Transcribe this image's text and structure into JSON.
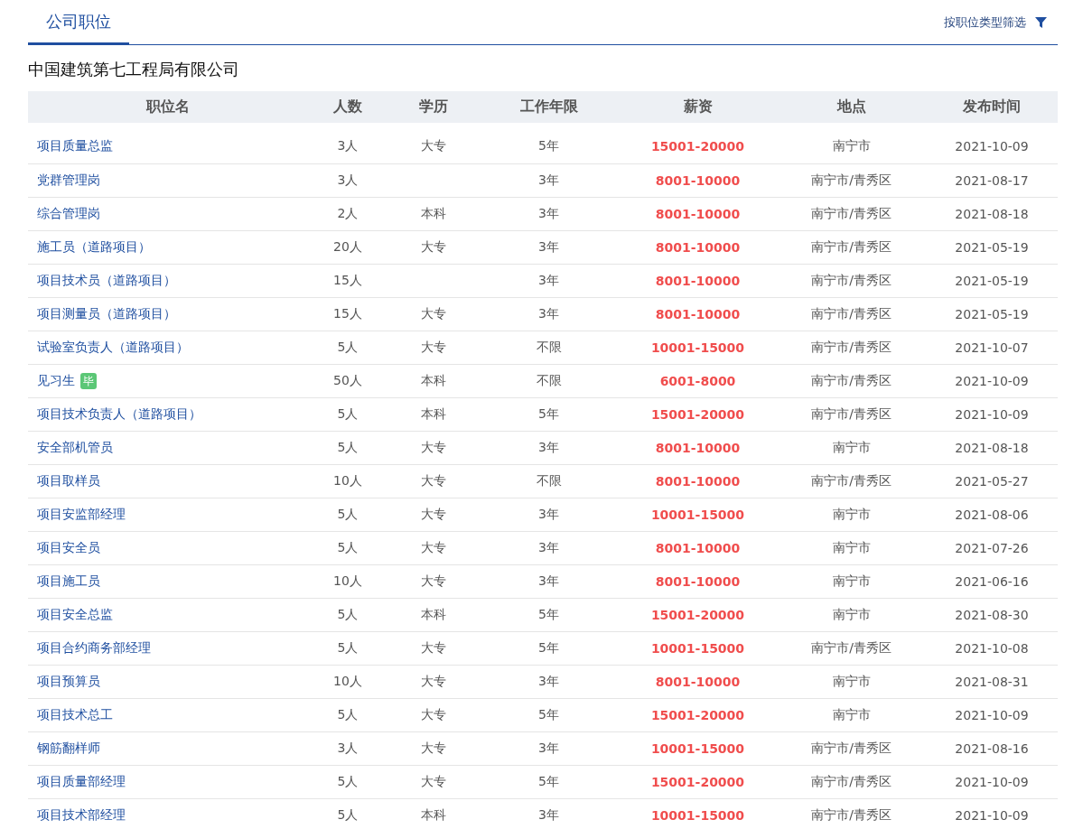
{
  "tabs": [
    {
      "label": "公司职位",
      "selected": true
    }
  ],
  "filter": {
    "label": "按职位类型筛选"
  },
  "company": "中国建筑第七工程局有限公司",
  "table": {
    "columns": [
      "职位名",
      "人数",
      "学历",
      "工作年限",
      "薪资",
      "地点",
      "发布时间"
    ],
    "rows": [
      {
        "name": "项目质量总监",
        "count": "3人",
        "education": "大专",
        "years": "5年",
        "salary": "15001-20000",
        "location": "南宁市",
        "date": "2021-10-09"
      },
      {
        "name": "党群管理岗",
        "count": "3人",
        "years": "3年",
        "salary": "8001-10000",
        "location": "南宁市/青秀区",
        "date": "2021-08-17"
      },
      {
        "name": "综合管理岗",
        "count": "2人",
        "education": "本科",
        "years": "3年",
        "salary": "8001-10000",
        "location": "南宁市/青秀区",
        "date": "2021-08-18"
      },
      {
        "name": "施工员（道路项目）",
        "count": "20人",
        "education": "大专",
        "years": "3年",
        "salary": "8001-10000",
        "location": "南宁市/青秀区",
        "date": "2021-05-19"
      },
      {
        "name": "项目技术员（道路项目）",
        "count": "15人",
        "years": "3年",
        "salary": "8001-10000",
        "location": "南宁市/青秀区",
        "date": "2021-05-19"
      },
      {
        "name": "项目测量员（道路项目）",
        "count": "15人",
        "education": "大专",
        "years": "3年",
        "salary": "8001-10000",
        "location": "南宁市/青秀区",
        "date": "2021-05-19"
      },
      {
        "name": "试验室负责人（道路项目）",
        "count": "5人",
        "education": "大专",
        "years": "不限",
        "salary": "10001-15000",
        "location": "南宁市/青秀区",
        "date": "2021-10-07"
      },
      {
        "name": "见习生",
        "badge": "毕",
        "count": "50人",
        "education": "本科",
        "years": "不限",
        "salary": "6001-8000",
        "location": "南宁市/青秀区",
        "date": "2021-10-09"
      },
      {
        "name": "项目技术负责人（道路项目）",
        "count": "5人",
        "education": "本科",
        "years": "5年",
        "salary": "15001-20000",
        "location": "南宁市/青秀区",
        "date": "2021-10-09"
      },
      {
        "name": "安全部机管员",
        "count": "5人",
        "education": "大专",
        "years": "3年",
        "salary": "8001-10000",
        "location": "南宁市",
        "date": "2021-08-18"
      },
      {
        "name": "项目取样员",
        "count": "10人",
        "education": "大专",
        "years": "不限",
        "salary": "8001-10000",
        "location": "南宁市/青秀区",
        "date": "2021-05-27"
      },
      {
        "name": "项目安监部经理",
        "count": "5人",
        "education": "大专",
        "years": "3年",
        "salary": "10001-15000",
        "location": "南宁市",
        "date": "2021-08-06"
      },
      {
        "name": "项目安全员",
        "count": "5人",
        "education": "大专",
        "years": "3年",
        "salary": "8001-10000",
        "location": "南宁市",
        "date": "2021-07-26"
      },
      {
        "name": "项目施工员",
        "count": "10人",
        "education": "大专",
        "years": "3年",
        "salary": "8001-10000",
        "location": "南宁市",
        "date": "2021-06-16"
      },
      {
        "name": "项目安全总监",
        "count": "5人",
        "education": "本科",
        "years": "5年",
        "salary": "15001-20000",
        "location": "南宁市",
        "date": "2021-08-30"
      },
      {
        "name": "项目合约商务部经理",
        "count": "5人",
        "education": "大专",
        "years": "5年",
        "salary": "10001-15000",
        "location": "南宁市/青秀区",
        "date": "2021-10-08"
      },
      {
        "name": "项目预算员",
        "count": "10人",
        "education": "大专",
        "years": "3年",
        "salary": "8001-10000",
        "location": "南宁市",
        "date": "2021-08-31"
      },
      {
        "name": "项目技术总工",
        "count": "5人",
        "education": "大专",
        "years": "5年",
        "salary": "15001-20000",
        "location": "南宁市",
        "date": "2021-10-09"
      },
      {
        "name": "钢筋翻样师",
        "count": "3人",
        "education": "大专",
        "years": "3年",
        "salary": "10001-15000",
        "location": "南宁市/青秀区",
        "date": "2021-08-16"
      },
      {
        "name": "项目质量部经理",
        "count": "5人",
        "education": "大专",
        "years": "5年",
        "salary": "15001-20000",
        "location": "南宁市/青秀区",
        "date": "2021-10-09"
      },
      {
        "name": "项目技术部经理",
        "count": "5人",
        "education": "本科",
        "years": "3年",
        "salary": "10001-15000",
        "location": "南宁市/青秀区",
        "date": "2021-10-09"
      }
    ]
  }
}
